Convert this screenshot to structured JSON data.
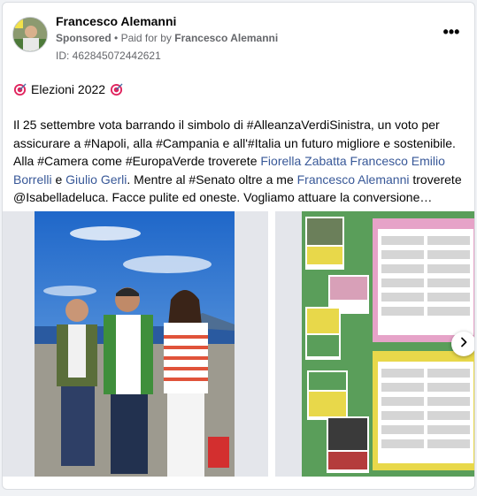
{
  "post": {
    "author": "Francesco Alemanni",
    "sponsored_label": "Sponsored",
    "separator": "•",
    "paid_for_prefix": "Paid for by",
    "paid_for_name": "Francesco Alemanni",
    "ad_id": "ID: 462845072442621",
    "menu_label": "•••",
    "headline": "Elezioni 2022",
    "text": {
      "p1": "Il 25 settembre vota barrando il simbolo di #AlleanzaVerdiSinistra, un voto per assicurare a #Napoli, alla #Campania e all'#Italia un futuro migliore e sostenibile.",
      "p2a": "Alla #Camera come #EuropaVerde troverete ",
      "link_fiorella": "Fiorella Zabatta",
      "space1": " ",
      "link_francesco": "Francesco Emilio Borrelli",
      "and1": " e ",
      "link_giulio": "Giulio Gerli",
      "p2b": ". Mentre al #Senato oltre a me ",
      "link_alemanni": "Francesco Alemanni",
      "p2c": " troverete @Isabelladeluca. Facce pulite ed oneste. Vogliamo attuare la conversione…"
    }
  },
  "colors": {
    "link": "#385898",
    "secondary_text": "#65676b",
    "ballot_green": "#5a9e5a",
    "ballot_pink": "#e6a3c8",
    "ballot_yellow": "#e8d84a"
  },
  "icons": {
    "target": "direct-hit-icon",
    "next": "chevron-right-icon",
    "menu": "more-options-icon"
  }
}
